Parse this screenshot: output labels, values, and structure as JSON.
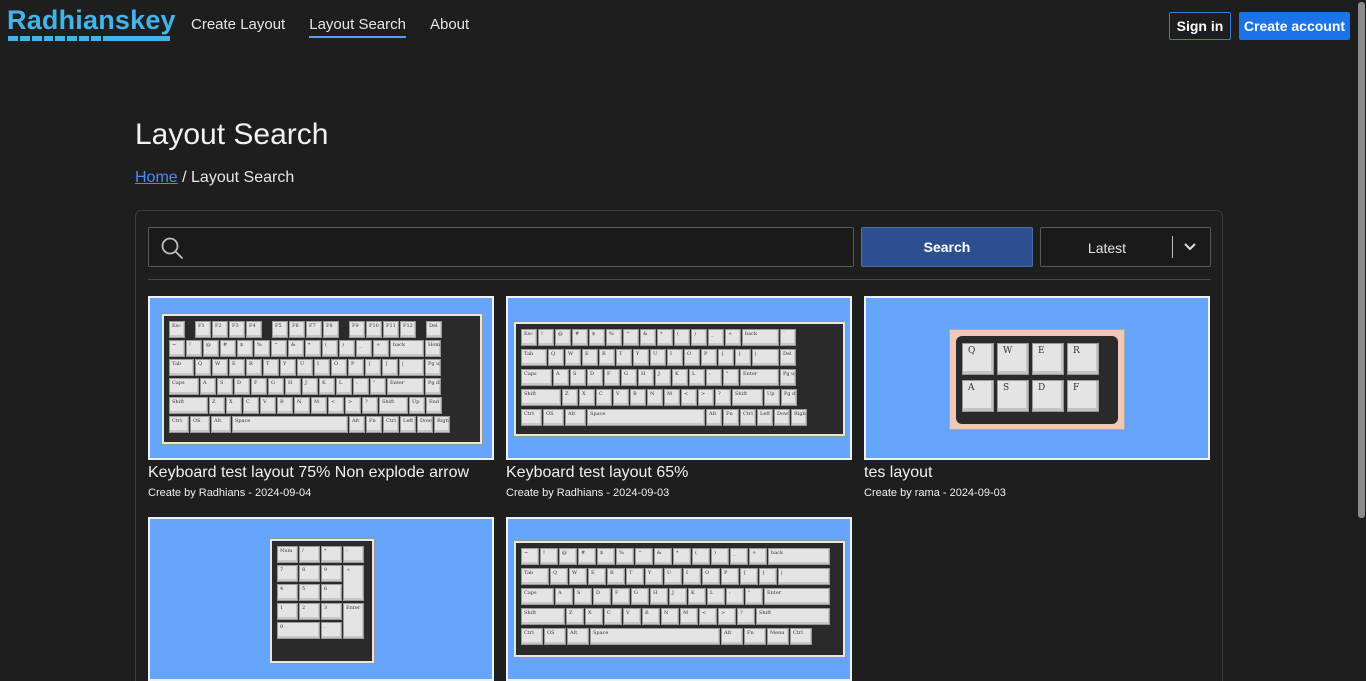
{
  "app": {
    "logo": "Radhianskey",
    "accent": "#42b4ea"
  },
  "nav": {
    "links": [
      "Create Layout",
      "Layout Search",
      "About"
    ],
    "active": "Layout Search",
    "sign_in": "Sign in",
    "create_account": "Create account"
  },
  "page": {
    "title": "Layout Search"
  },
  "breadcrumb": {
    "home": "Home",
    "separator": " / ",
    "current": "Layout Search"
  },
  "search": {
    "value": "",
    "placeholder": "",
    "button": "Search",
    "sort_selected": "Latest",
    "icon": "search-icon"
  },
  "cards": [
    {
      "title": "Keyboard test layout 75% Non explode arrow",
      "meta": "Create by Radhians - 2024-09-04"
    },
    {
      "title": "Keyboard test layout 65%",
      "meta": "Create by Radhians - 2024-09-03"
    },
    {
      "title": "tes layout",
      "meta": "Create by rama - 2024-09-03"
    },
    {
      "title": "",
      "meta": ""
    },
    {
      "title": "",
      "meta": ""
    }
  ],
  "colors": {
    "thumb_bg": "#64a4fa",
    "primary": "#1a73e8",
    "search_button": "#2e4f8f"
  }
}
